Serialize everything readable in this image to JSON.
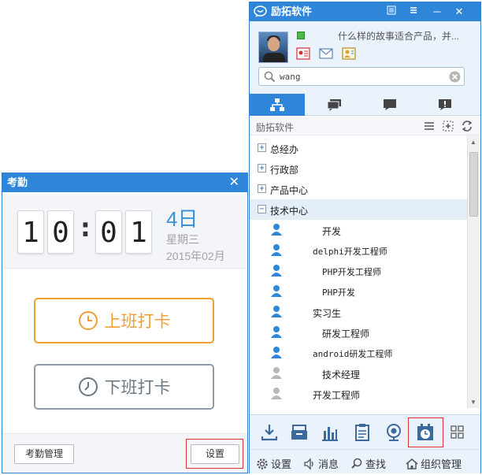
{
  "attendance": {
    "title": "考勤",
    "close_glyph": "✕",
    "clock": {
      "digits": [
        "1",
        "0",
        "0",
        "1"
      ],
      "separator": ":"
    },
    "date": {
      "day": "4日",
      "weekday": "星期三",
      "year_month": "2015年02月"
    },
    "clock_in_label": "上班打卡",
    "clock_out_label": "下班打卡",
    "manage_label": "考勤管理",
    "settings_label": "设置",
    "colors": {
      "accent_orange": "#f0a033",
      "accent_blue": "#3a93d8",
      "highlight_red": "#e03030"
    }
  },
  "im": {
    "app_name": "励拓软件",
    "window_controls": {
      "minimize": "─",
      "close": "✕"
    },
    "profile": {
      "signature": "什么样的故事适合产品，并..."
    },
    "search": {
      "value": "wang"
    },
    "group_header": {
      "label": "励拓软件"
    },
    "tree": {
      "departments": [
        {
          "expander": "+",
          "label": "总经办"
        },
        {
          "expander": "+",
          "label": "行政部"
        },
        {
          "expander": "+",
          "label": "产品中心"
        },
        {
          "expander": "−",
          "label": "技术中心"
        }
      ],
      "members": [
        {
          "title": "开发",
          "mono": false,
          "online": true
        },
        {
          "title": "delphi开发工程师",
          "mono": true,
          "online": true
        },
        {
          "title": "PHP开发工程师",
          "mono": true,
          "online": true
        },
        {
          "title": "PHP开发",
          "mono": true,
          "online": true
        },
        {
          "title": "实习生",
          "mono": false,
          "online": true
        },
        {
          "title": "研发工程师",
          "mono": false,
          "online": true
        },
        {
          "title": "android研发工程师",
          "mono": true,
          "online": true
        },
        {
          "title": "技术经理",
          "mono": false,
          "online": false
        },
        {
          "title": "开发工程师",
          "mono": false,
          "online": false
        }
      ]
    },
    "bottom": {
      "settings": "设置",
      "messages": "消息",
      "find": "查找",
      "org": "组织管理"
    }
  }
}
